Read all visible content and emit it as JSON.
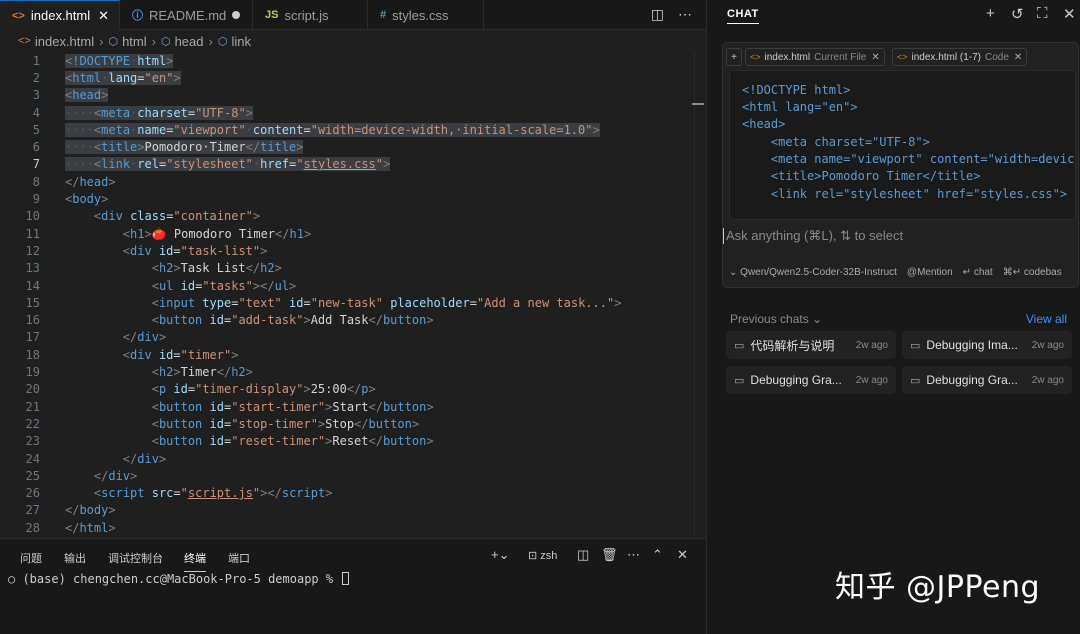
{
  "tabs": [
    {
      "label": "index.html",
      "icon": "<>",
      "active": true,
      "close": "✕"
    },
    {
      "label": "README.md",
      "icon": "ⓘ",
      "active": false,
      "modified": true
    },
    {
      "label": "script.js",
      "icon": "JS",
      "active": false
    },
    {
      "label": "styles.css",
      "icon": "#",
      "active": false
    }
  ],
  "breadcrumb": [
    "index.html",
    "html",
    "head",
    "link"
  ],
  "code_lines": [
    {
      "n": "1",
      "html": "<span class=\"sel\"><span class=\"pu\">&lt;</span><span class=\"tg\">!DOCTYPE</span><span class=\"ws\">·</span><span class=\"at\">html</span><span class=\"pu\">&gt;</span></span>"
    },
    {
      "n": "2",
      "html": "<span class=\"sel\"><span class=\"pu\">&lt;</span><span class=\"tg\">html</span><span class=\"ws\">·</span><span class=\"at\">lang</span><span class=\"tx\">=</span><span class=\"st\">\"en\"</span><span class=\"pu\">&gt;</span></span>"
    },
    {
      "n": "3",
      "html": "<span class=\"sel\"><span class=\"pu\">&lt;</span><span class=\"tg\">head</span><span class=\"pu\">&gt;</span></span>"
    },
    {
      "n": "4",
      "html": "<span class=\"sel\"><span class=\"ws\">····</span><span class=\"pu\">&lt;</span><span class=\"tg\">meta</span><span class=\"ws\">·</span><span class=\"at\">charset</span><span class=\"tx\">=</span><span class=\"st\">\"UTF-8\"</span><span class=\"pu\">&gt;</span></span>"
    },
    {
      "n": "5",
      "html": "<span class=\"sel\"><span class=\"ws\">····</span><span class=\"pu\">&lt;</span><span class=\"tg\">meta</span><span class=\"ws\">·</span><span class=\"at\">name</span><span class=\"tx\">=</span><span class=\"st\">\"viewport\"</span><span class=\"ws\">·</span><span class=\"at\">content</span><span class=\"tx\">=</span><span class=\"st\">\"width=device-width,·initial-scale=1.0\"</span><span class=\"pu\">&gt;</span></span>"
    },
    {
      "n": "6",
      "html": "<span class=\"sel\"><span class=\"ws\">····</span><span class=\"pu\">&lt;</span><span class=\"tg\">title</span><span class=\"pu\">&gt;</span><span class=\"tx\">Pomodoro·Timer</span><span class=\"pu\">&lt;/</span><span class=\"tg\">title</span><span class=\"pu\">&gt;</span></span>"
    },
    {
      "n": "7",
      "cur": true,
      "html": "<span class=\"sel\"><span class=\"ws\">····</span><span class=\"pu\">&lt;</span><span class=\"tg\">link</span><span class=\"ws\">·</span><span class=\"at\">rel</span><span class=\"tx\">=</span><span class=\"st\">\"stylesheet\"</span><span class=\"ws\">·</span><span class=\"at\">href</span><span class=\"tx\">=</span><span class=\"st\">\"<span class=\"ul\">styles.css</span>\"</span><span class=\"pu\">&gt;</span></span>"
    },
    {
      "n": "8",
      "html": "<span class=\"pu\">&lt;/</span><span class=\"tg\">head</span><span class=\"pu\">&gt;</span>"
    },
    {
      "n": "9",
      "html": "<span class=\"pu\">&lt;</span><span class=\"tg\">body</span><span class=\"pu\">&gt;</span>"
    },
    {
      "n": "10",
      "html": "    <span class=\"pu\">&lt;</span><span class=\"tg\">div</span> <span class=\"at\">class</span><span class=\"tx\">=</span><span class=\"st\">\"container\"</span><span class=\"pu\">&gt;</span>"
    },
    {
      "n": "11",
      "html": "        <span class=\"pu\">&lt;</span><span class=\"tg\">h1</span><span class=\"pu\">&gt;</span><span class=\"tx\">🍅 Pomodoro Timer</span><span class=\"pu\">&lt;/</span><span class=\"tg\">h1</span><span class=\"pu\">&gt;</span>"
    },
    {
      "n": "12",
      "html": "        <span class=\"pu\">&lt;</span><span class=\"tg\">div</span> <span class=\"at\">id</span><span class=\"tx\">=</span><span class=\"st\">\"task-list\"</span><span class=\"pu\">&gt;</span>"
    },
    {
      "n": "13",
      "html": "            <span class=\"pu\">&lt;</span><span class=\"tg\">h2</span><span class=\"pu\">&gt;</span><span class=\"tx\">Task List</span><span class=\"pu\">&lt;/</span><span class=\"tg\">h2</span><span class=\"pu\">&gt;</span>"
    },
    {
      "n": "14",
      "html": "            <span class=\"pu\">&lt;</span><span class=\"tg\">ul</span> <span class=\"at\">id</span><span class=\"tx\">=</span><span class=\"st\">\"tasks\"</span><span class=\"pu\">&gt;&lt;/</span><span class=\"tg\">ul</span><span class=\"pu\">&gt;</span>"
    },
    {
      "n": "15",
      "html": "            <span class=\"pu\">&lt;</span><span class=\"tg\">input</span> <span class=\"at\">type</span><span class=\"tx\">=</span><span class=\"st\">\"text\"</span> <span class=\"at\">id</span><span class=\"tx\">=</span><span class=\"st\">\"new-task\"</span> <span class=\"at\">placeholder</span><span class=\"tx\">=</span><span class=\"st\">\"Add a new task...\"</span><span class=\"pu\">&gt;</span>"
    },
    {
      "n": "16",
      "html": "            <span class=\"pu\">&lt;</span><span class=\"tg\">button</span> <span class=\"at\">id</span><span class=\"tx\">=</span><span class=\"st\">\"add-task\"</span><span class=\"pu\">&gt;</span><span class=\"tx\">Add Task</span><span class=\"pu\">&lt;/</span><span class=\"tg\">button</span><span class=\"pu\">&gt;</span>"
    },
    {
      "n": "17",
      "html": "        <span class=\"pu\">&lt;/</span><span class=\"tg\">div</span><span class=\"pu\">&gt;</span>"
    },
    {
      "n": "18",
      "html": "        <span class=\"pu\">&lt;</span><span class=\"tg\">div</span> <span class=\"at\">id</span><span class=\"tx\">=</span><span class=\"st\">\"timer\"</span><span class=\"pu\">&gt;</span>"
    },
    {
      "n": "19",
      "html": "            <span class=\"pu\">&lt;</span><span class=\"tg\">h2</span><span class=\"pu\">&gt;</span><span class=\"tx\">Timer</span><span class=\"pu\">&lt;/</span><span class=\"tg\">h2</span><span class=\"pu\">&gt;</span>"
    },
    {
      "n": "20",
      "html": "            <span class=\"pu\">&lt;</span><span class=\"tg\">p</span> <span class=\"at\">id</span><span class=\"tx\">=</span><span class=\"st\">\"timer-display\"</span><span class=\"pu\">&gt;</span><span class=\"tx\">25:00</span><span class=\"pu\">&lt;/</span><span class=\"tg\">p</span><span class=\"pu\">&gt;</span>"
    },
    {
      "n": "21",
      "html": "            <span class=\"pu\">&lt;</span><span class=\"tg\">button</span> <span class=\"at\">id</span><span class=\"tx\">=</span><span class=\"st\">\"start-timer\"</span><span class=\"pu\">&gt;</span><span class=\"tx\">Start</span><span class=\"pu\">&lt;/</span><span class=\"tg\">button</span><span class=\"pu\">&gt;</span>"
    },
    {
      "n": "22",
      "html": "            <span class=\"pu\">&lt;</span><span class=\"tg\">button</span> <span class=\"at\">id</span><span class=\"tx\">=</span><span class=\"st\">\"stop-timer\"</span><span class=\"pu\">&gt;</span><span class=\"tx\">Stop</span><span class=\"pu\">&lt;/</span><span class=\"tg\">button</span><span class=\"pu\">&gt;</span>"
    },
    {
      "n": "23",
      "html": "            <span class=\"pu\">&lt;</span><span class=\"tg\">button</span> <span class=\"at\">id</span><span class=\"tx\">=</span><span class=\"st\">\"reset-timer\"</span><span class=\"pu\">&gt;</span><span class=\"tx\">Reset</span><span class=\"pu\">&lt;/</span><span class=\"tg\">button</span><span class=\"pu\">&gt;</span>"
    },
    {
      "n": "24",
      "html": "        <span class=\"pu\">&lt;/</span><span class=\"tg\">div</span><span class=\"pu\">&gt;</span>"
    },
    {
      "n": "25",
      "html": "    <span class=\"pu\">&lt;/</span><span class=\"tg\">div</span><span class=\"pu\">&gt;</span>"
    },
    {
      "n": "26",
      "html": "    <span class=\"pu\">&lt;</span><span class=\"tg\">script</span> <span class=\"at\">src</span><span class=\"tx\">=</span><span class=\"st\">\"<span class=\"ul\">script.js</span>\"</span><span class=\"pu\">&gt;&lt;/</span><span class=\"tg\">script</span><span class=\"pu\">&gt;</span>"
    },
    {
      "n": "27",
      "html": "<span class=\"pu\">&lt;/</span><span class=\"tg\">body</span><span class=\"pu\">&gt;</span>"
    },
    {
      "n": "28",
      "html": "<span class=\"pu\">&lt;/</span><span class=\"tg\">html</span><span class=\"pu\">&gt;</span>"
    }
  ],
  "panel": {
    "tabs": [
      "问题",
      "输出",
      "调试控制台",
      "终端",
      "端口"
    ],
    "active_tab": "终端",
    "shell": "zsh",
    "terminal_line": "○ (base) chengchen.cc@MacBook-Pro-5 demoapp % "
  },
  "chat": {
    "title": "CHAT",
    "context_pills": [
      {
        "name": "index.html",
        "kind": "Current File"
      },
      {
        "name": "index.html (1-7)",
        "kind": "Code"
      }
    ],
    "snippet_lines": [
      "<!DOCTYPE html>",
      "<html lang=\"en\">",
      "<head>",
      "    <meta charset=\"UTF-8\">",
      "    <meta name=\"viewport\" content=\"width=device",
      "    <title>Pomodoro Timer</title>",
      "    <link rel=\"stylesheet\" href=\"styles.css\">"
    ],
    "input_placeholder": "Ask anything (⌘L), ⇅ to select",
    "model": "Qwen/Qwen2.5-Coder-32B-Instruct",
    "mention": "Mention",
    "chat_hint": "chat",
    "codebase_hint": "codebas",
    "previous_label": "Previous chats",
    "view_all": "View all",
    "history": [
      {
        "title": "代码解析与说明",
        "when": "2w ago"
      },
      {
        "title": "Debugging Ima...",
        "when": "2w ago"
      },
      {
        "title": "Debugging Gra...",
        "when": "2w ago"
      },
      {
        "title": "Debugging Gra...",
        "when": "2w ago"
      }
    ]
  },
  "watermark": "知乎 @JPPeng",
  "colors": {
    "accent": "#0078d4",
    "link": "#3794ff",
    "tag": "#569cd6",
    "attr": "#9cdcfe",
    "string": "#ce9178"
  }
}
